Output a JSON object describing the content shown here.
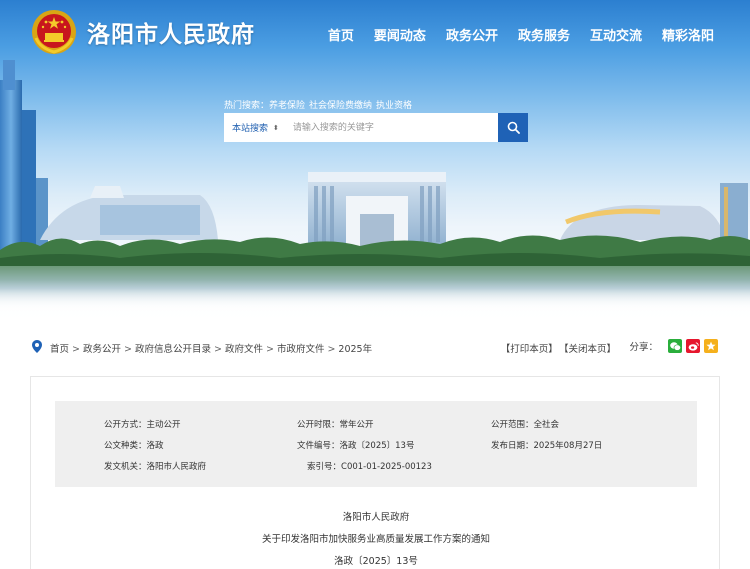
{
  "header": {
    "site_title": "洛阳市人民政府",
    "nav": [
      "首页",
      "要闻动态",
      "政务公开",
      "政务服务",
      "互动交流",
      "精彩洛阳"
    ]
  },
  "search": {
    "hot_label": "热门搜索：",
    "hot_words": [
      "养老保险",
      "社会保险费缴纳",
      "执业资格"
    ],
    "scope": "本站搜索",
    "placeholder": "请输入搜索的关键字"
  },
  "breadcrumb": {
    "items": [
      "首页",
      "政务公开",
      "政府信息公开目录",
      "政府文件",
      "市政府文件",
      "2025年"
    ],
    "separator": ">"
  },
  "tools": {
    "print": "【打印本页】",
    "close": "【关闭本页】",
    "share_label": "分享："
  },
  "meta": {
    "row1": {
      "a_key": "公开方式：",
      "a_val": "主动公开",
      "b_key": "公开时限：",
      "b_val": "常年公开",
      "c_key": "公开范围：",
      "c_val": "全社会"
    },
    "row2": {
      "a_key": "公文种类：",
      "a_val": "洛政",
      "b_key": "文件编号：",
      "b_val": "洛政〔2025〕13号",
      "c_key": "发布日期：",
      "c_val": "2025年08月27日"
    },
    "row3": {
      "a_key": "发文机关：",
      "a_val": "洛阳市人民政府",
      "b_key": "索引号：",
      "b_val": "C001-01-2025-00123"
    }
  },
  "document": {
    "issuer": "洛阳市人民政府",
    "title": "关于印发洛阳市加快服务业高质量发展工作方案的通知",
    "number": "洛政〔2025〕13号"
  },
  "colors": {
    "primary_blue": "#1f62b6",
    "wechat_green": "#2aae3c",
    "weibo_red": "#e6162d",
    "qzone_yellow": "#f5b01c"
  },
  "icons": [
    "national-emblem-icon",
    "search-icon",
    "location-pin-icon",
    "wechat-icon",
    "weibo-icon",
    "qzone-icon"
  ]
}
